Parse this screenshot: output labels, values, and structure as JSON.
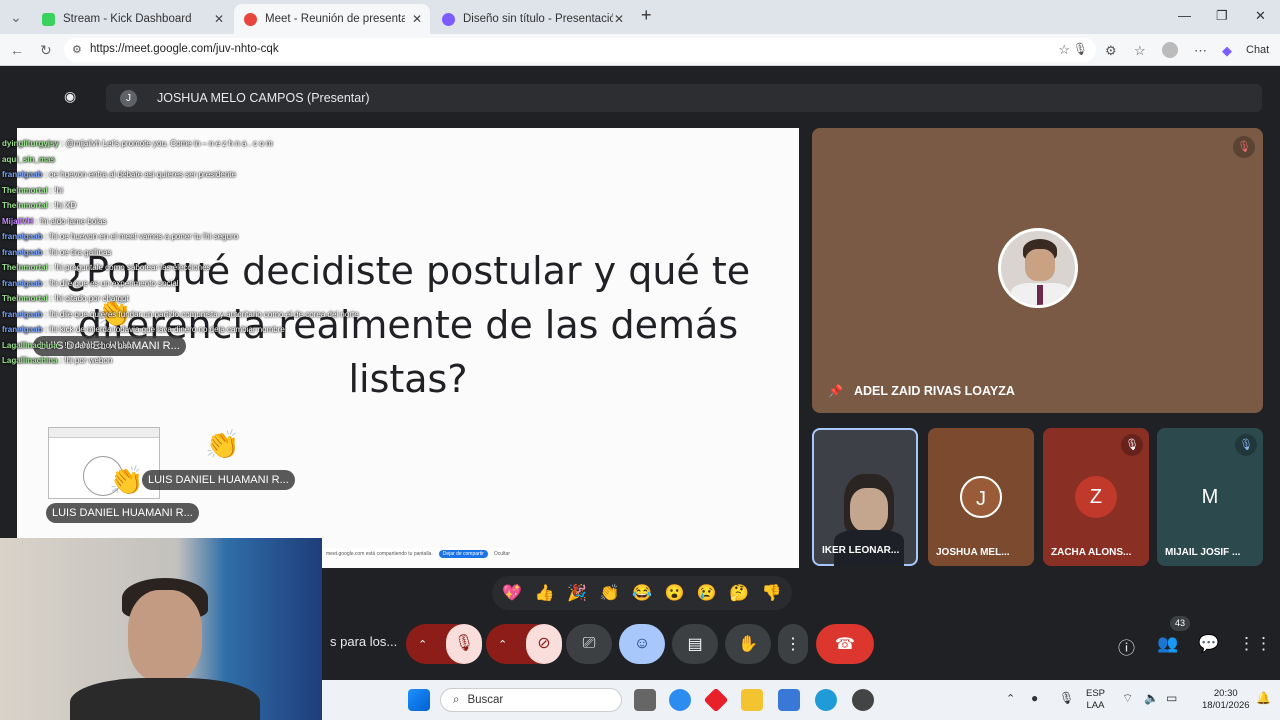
{
  "browser": {
    "tabs": [
      {
        "title": "Stream - Kick Dashboard",
        "color": "#3ad25f"
      },
      {
        "title": "Meet - Reunión de presentación",
        "color": "#e8453c"
      },
      {
        "title": "Diseño sin título - Presentación",
        "color": "#7d5cff"
      }
    ],
    "url": "https://meet.google.com/juv-nhto-cqk",
    "chat_label": "Chat",
    "new_tab": "+"
  },
  "meet": {
    "presenter_initial": "J",
    "presenter_label": "JOSHUA MELO CAMPOS (Presentar)",
    "slide_question": "¿Por qué decidiste postular y qué te diferencia realmente de las demás listas?",
    "reaction_names": [
      "LUIS DANIEL HUAMANI R...",
      "LUIS DANIEL HUAMANI R...",
      "LUIS DANIEL HUAMANI R..."
    ],
    "share_text": "meet.google.com está compartiendo tu pantalla.",
    "share_button": "Dejar de compartir",
    "share_hide": "Ocultar",
    "pinned_name": "ADEL ZAID RIVAS LOAYZA",
    "tiles": [
      {
        "name": "IKER LEONAR...",
        "initial": "",
        "color": "#3d4046"
      },
      {
        "name": "JOSHUA MEL...",
        "initial": "J",
        "color": "#7b4a2f"
      },
      {
        "name": "ZACHA ALONS...",
        "initial": "Z",
        "color": "#8a2f24"
      },
      {
        "name": "MIJAIL JOSIF ...",
        "initial": "M",
        "color": "#2c4a4e"
      }
    ],
    "reactions": [
      "💖",
      "👍",
      "🎉",
      "👏",
      "😂",
      "😮",
      "😢",
      "🤔",
      "👎"
    ],
    "left_label": "s para los...",
    "participants_count": "43"
  },
  "chat": [
    {
      "user": "dyingliturgyjsy",
      "msg": "@mijailvh Let's promote  you. Come  in – n e z h n a . c o m",
      "color": "green"
    },
    {
      "user": "aqui_sin_mas",
      "msg": "",
      "color": "green"
    },
    {
      "user": "franelgaab",
      "msg": "oe huevon entra al debate asi quieres ser presidente",
      "color": "blue"
    },
    {
      "user": "TheInmortal",
      "msg": "!hi",
      "color": "green"
    },
    {
      "user": "TheInmortal",
      "msg": "!hi XD",
      "color": "green"
    },
    {
      "user": "MijailVH",
      "msg": "!hi aldo lame bolas",
      "color": "purple"
    },
    {
      "user": "franelgaab",
      "msg": "!hi oe huevon en el meet vamos a poner tu !hi seguro",
      "color": "blue"
    },
    {
      "user": "franelgaab",
      "msg": "!hi oe tira gallinas",
      "color": "blue"
    },
    {
      "user": "TheInmortal",
      "msg": "!hi preguntale como sabotear las elecciones",
      "color": "green"
    },
    {
      "user": "franelgaab",
      "msg": "!hi dile que es un experimento social",
      "color": "blue"
    },
    {
      "user": "TheInmortal",
      "msg": "!hi citado por chatgpt",
      "color": "green"
    },
    {
      "user": "franelgaab",
      "msg": "!hi dile que quieres fundar un partido comunista y autoritario como el de corea del norte",
      "color": "blue"
    },
    {
      "user": "franelgaab",
      "msg": "!hi kick de mierda todavia que lava dinero no deja cambiar nombre",
      "color": "blue"
    },
    {
      "user": "Lagallinachina",
      "msg": "!hi damo chow papi",
      "color": "green"
    },
    {
      "user": "Lagallinachina",
      "msg": "!hi por webon",
      "color": "green"
    }
  ],
  "taskbar": {
    "search_placeholder": "Buscar",
    "lang_top": "ESP",
    "lang_bottom": "LAA",
    "time": "20:30",
    "date": "18/01/2026"
  }
}
